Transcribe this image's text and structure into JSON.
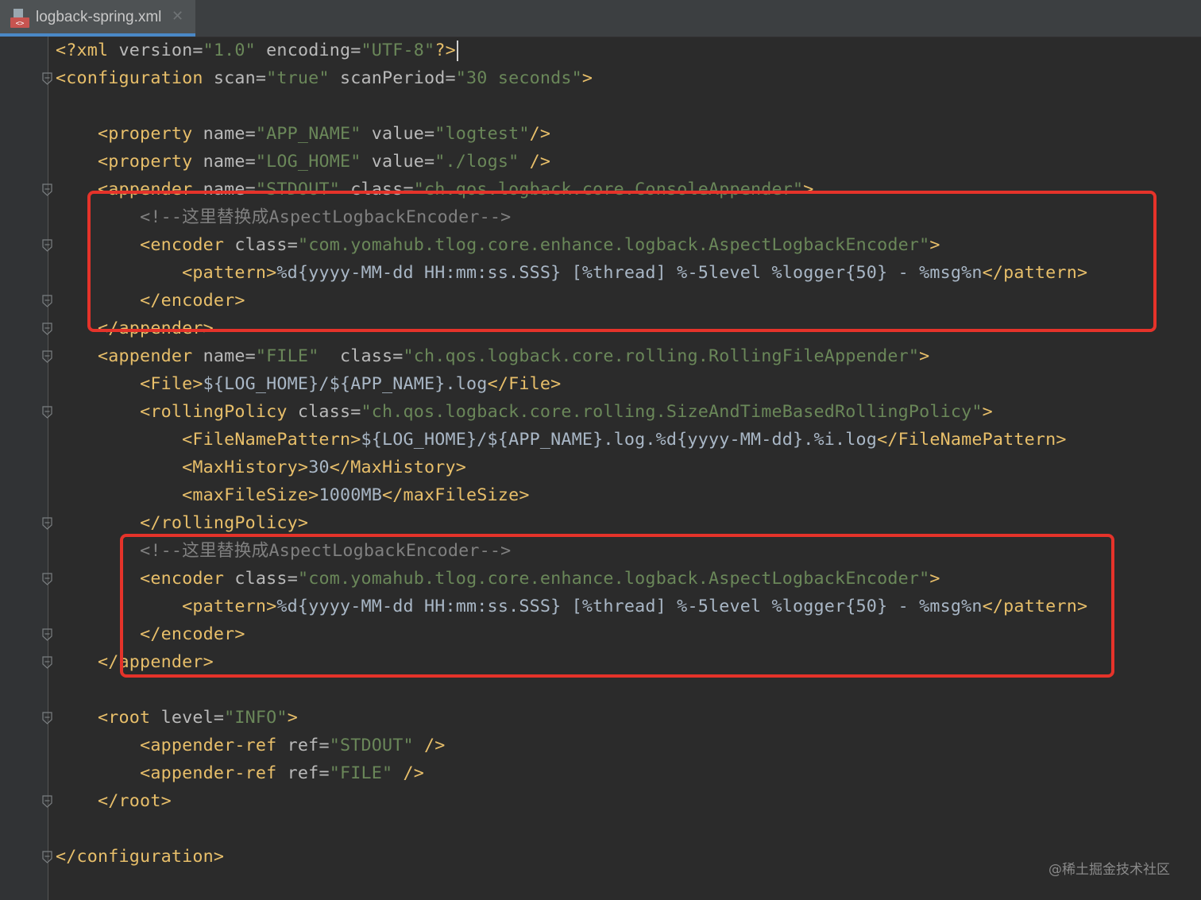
{
  "tab": {
    "title": "logback-spring.xml",
    "icon": "xml-file-icon",
    "close_icon": "close-icon",
    "close_glyph": "✕"
  },
  "code_lines": [
    [
      [
        "t",
        "<?xml "
      ],
      [
        "a",
        "version"
      ],
      [
        "a",
        "="
      ],
      [
        "v",
        "\"1.0\""
      ],
      [
        "a",
        " encoding"
      ],
      [
        "a",
        "="
      ],
      [
        "v",
        "\"UTF-8\""
      ],
      [
        "t",
        "?>"
      ]
    ],
    [
      [
        "t",
        "<configuration "
      ],
      [
        "a",
        "scan"
      ],
      [
        "a",
        "="
      ],
      [
        "v",
        "\"true\""
      ],
      [
        "a",
        " scanPeriod"
      ],
      [
        "a",
        "="
      ],
      [
        "v",
        "\"30 seconds\""
      ],
      [
        "t",
        ">"
      ]
    ],
    [],
    [
      [
        "x",
        "    "
      ],
      [
        "t",
        "<property "
      ],
      [
        "a",
        "name"
      ],
      [
        "a",
        "="
      ],
      [
        "v",
        "\"APP_NAME\""
      ],
      [
        "a",
        " value"
      ],
      [
        "a",
        "="
      ],
      [
        "v",
        "\"logtest\""
      ],
      [
        "t",
        "/>"
      ]
    ],
    [
      [
        "x",
        "    "
      ],
      [
        "t",
        "<property "
      ],
      [
        "a",
        "name"
      ],
      [
        "a",
        "="
      ],
      [
        "v",
        "\"LOG_HOME\""
      ],
      [
        "a",
        " value"
      ],
      [
        "a",
        "="
      ],
      [
        "v",
        "\"./logs\""
      ],
      [
        "t",
        " />"
      ]
    ],
    [
      [
        "x",
        "    "
      ],
      [
        "t",
        "<appender "
      ],
      [
        "a",
        "name"
      ],
      [
        "a",
        "="
      ],
      [
        "v",
        "\"STDOUT\""
      ],
      [
        "a",
        " class"
      ],
      [
        "a",
        "="
      ],
      [
        "v",
        "\"ch.qos.logback.core.ConsoleAppender\""
      ],
      [
        "t",
        ">"
      ]
    ],
    [
      [
        "x",
        "        "
      ],
      [
        "c",
        "<!--这里替换成AspectLogbackEncoder-->"
      ]
    ],
    [
      [
        "x",
        "        "
      ],
      [
        "t",
        "<encoder "
      ],
      [
        "a",
        "class"
      ],
      [
        "a",
        "="
      ],
      [
        "v",
        "\"com.yomahub.tlog.core.enhance.logback.AspectLogbackEncoder\""
      ],
      [
        "t",
        ">"
      ]
    ],
    [
      [
        "x",
        "            "
      ],
      [
        "t",
        "<pattern>"
      ],
      [
        "e",
        "%d{yyyy-MM-dd HH:mm:ss.SSS} [%thread] %-5level %logger{50} - %msg%n"
      ],
      [
        "t",
        "</pattern>"
      ]
    ],
    [
      [
        "x",
        "        "
      ],
      [
        "t",
        "</encoder>"
      ]
    ],
    [
      [
        "x",
        "    "
      ],
      [
        "t",
        "</appender>"
      ]
    ],
    [
      [
        "x",
        "    "
      ],
      [
        "t",
        "<appender "
      ],
      [
        "a",
        "name"
      ],
      [
        "a",
        "="
      ],
      [
        "v",
        "\"FILE\""
      ],
      [
        "a",
        "  class"
      ],
      [
        "a",
        "="
      ],
      [
        "v",
        "\"ch.qos.logback.core.rolling.RollingFileAppender\""
      ],
      [
        "t",
        ">"
      ]
    ],
    [
      [
        "x",
        "        "
      ],
      [
        "t",
        "<File>"
      ],
      [
        "e",
        "${LOG_HOME}/${APP_NAME}.log"
      ],
      [
        "t",
        "</File>"
      ]
    ],
    [
      [
        "x",
        "        "
      ],
      [
        "t",
        "<rollingPolicy "
      ],
      [
        "a",
        "class"
      ],
      [
        "a",
        "="
      ],
      [
        "v",
        "\"ch.qos.logback.core.rolling.SizeAndTimeBasedRollingPolicy\""
      ],
      [
        "t",
        ">"
      ]
    ],
    [
      [
        "x",
        "            "
      ],
      [
        "t",
        "<FileNamePattern>"
      ],
      [
        "e",
        "${LOG_HOME}/${APP_NAME}.log.%d{yyyy-MM-dd}.%i.log"
      ],
      [
        "t",
        "</FileNamePattern>"
      ]
    ],
    [
      [
        "x",
        "            "
      ],
      [
        "t",
        "<MaxHistory>"
      ],
      [
        "e",
        "30"
      ],
      [
        "t",
        "</MaxHistory>"
      ]
    ],
    [
      [
        "x",
        "            "
      ],
      [
        "t",
        "<maxFileSize>"
      ],
      [
        "e",
        "1000MB"
      ],
      [
        "t",
        "</maxFileSize>"
      ]
    ],
    [
      [
        "x",
        "        "
      ],
      [
        "t",
        "</rollingPolicy>"
      ]
    ],
    [
      [
        "x",
        "        "
      ],
      [
        "c",
        "<!--这里替换成AspectLogbackEncoder-->"
      ]
    ],
    [
      [
        "x",
        "        "
      ],
      [
        "t",
        "<encoder "
      ],
      [
        "a",
        "class"
      ],
      [
        "a",
        "="
      ],
      [
        "v",
        "\"com.yomahub.tlog.core.enhance.logback.AspectLogbackEncoder\""
      ],
      [
        "t",
        ">"
      ]
    ],
    [
      [
        "x",
        "            "
      ],
      [
        "t",
        "<pattern>"
      ],
      [
        "e",
        "%d{yyyy-MM-dd HH:mm:ss.SSS} [%thread] %-5level %logger{50} - %msg%n"
      ],
      [
        "t",
        "</pattern>"
      ]
    ],
    [
      [
        "x",
        "        "
      ],
      [
        "t",
        "</encoder>"
      ]
    ],
    [
      [
        "x",
        "    "
      ],
      [
        "t",
        "</appender>"
      ]
    ],
    [],
    [
      [
        "x",
        "    "
      ],
      [
        "t",
        "<root "
      ],
      [
        "a",
        "level"
      ],
      [
        "a",
        "="
      ],
      [
        "v",
        "\"INFO\""
      ],
      [
        "t",
        ">"
      ]
    ],
    [
      [
        "x",
        "        "
      ],
      [
        "t",
        "<appender-ref "
      ],
      [
        "a",
        "ref"
      ],
      [
        "a",
        "="
      ],
      [
        "v",
        "\"STDOUT\""
      ],
      [
        "t",
        " />"
      ]
    ],
    [
      [
        "x",
        "        "
      ],
      [
        "t",
        "<appender-ref "
      ],
      [
        "a",
        "ref"
      ],
      [
        "a",
        "="
      ],
      [
        "v",
        "\"FILE\""
      ],
      [
        "t",
        " />"
      ]
    ],
    [
      [
        "x",
        "    "
      ],
      [
        "t",
        "</root>"
      ]
    ],
    [],
    [
      [
        "t",
        "</configuration>"
      ]
    ]
  ],
  "watermark": "@稀土掘金技术社区",
  "colors": {
    "editor_bg": "#2b2b2b",
    "tag": "#e8bf6a",
    "attribute": "#bababa",
    "string": "#6a8759",
    "comment": "#808080",
    "highlight_box": "#e5332a",
    "tab_underline": "#4a88c7"
  }
}
